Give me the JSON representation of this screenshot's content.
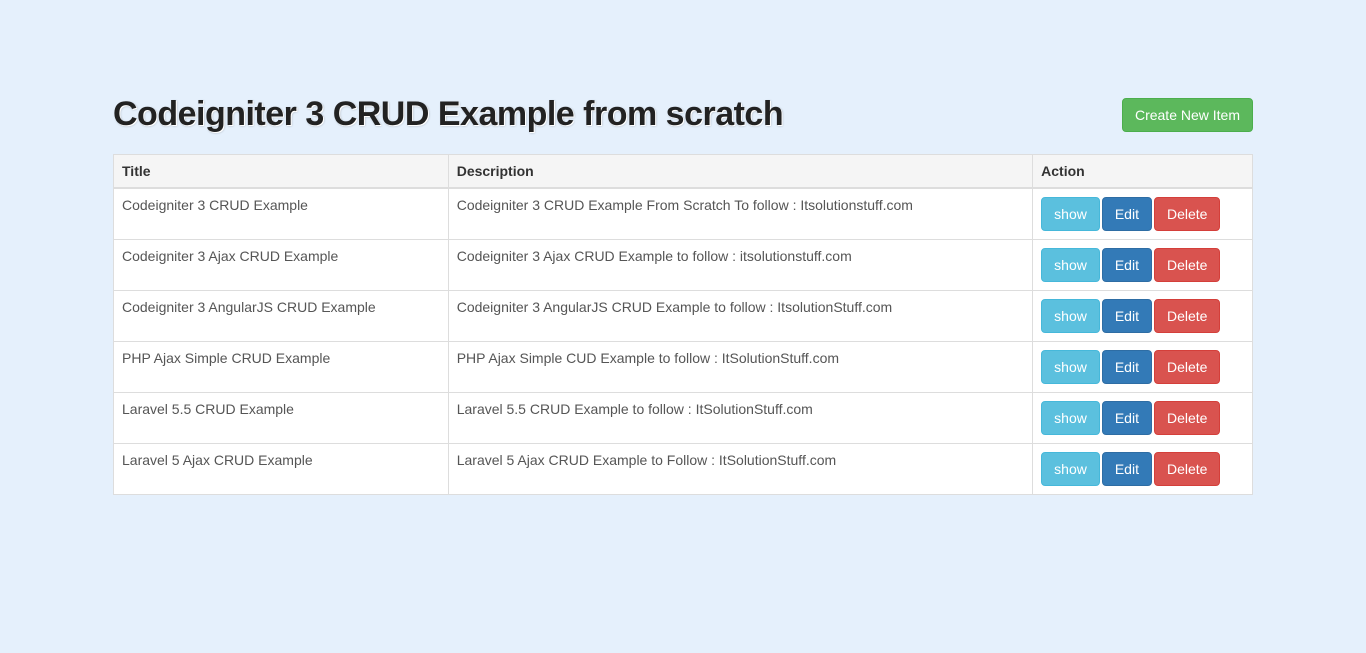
{
  "header": {
    "title": "Codeigniter 3 CRUD Example from scratch",
    "create_label": "Create New Item"
  },
  "table": {
    "columns": {
      "title": "Title",
      "description": "Description",
      "action": "Action"
    },
    "action_labels": {
      "show": "show",
      "edit": "Edit",
      "delete": "Delete"
    },
    "rows": [
      {
        "title": "Codeigniter 3 CRUD Example",
        "description": "Codeigniter 3 CRUD Example From Scratch To follow : Itsolutionstuff.com"
      },
      {
        "title": "Codeigniter 3 Ajax CRUD Example",
        "description": "Codeigniter 3 Ajax CRUD Example to follow : itsolutionstuff.com"
      },
      {
        "title": "Codeigniter 3 AngularJS CRUD Example",
        "description": "Codeigniter 3 AngularJS CRUD Example to follow : ItsolutionStuff.com"
      },
      {
        "title": "PHP Ajax Simple CRUD Example",
        "description": "PHP Ajax Simple CUD Example to follow : ItSolutionStuff.com"
      },
      {
        "title": "Laravel 5.5 CRUD Example",
        "description": "Laravel 5.5 CRUD Example to follow : ItSolutionStuff.com"
      },
      {
        "title": "Laravel 5 Ajax CRUD Example",
        "description": "Laravel 5 Ajax CRUD Example to Follow : ItSolutionStuff.com"
      }
    ]
  }
}
